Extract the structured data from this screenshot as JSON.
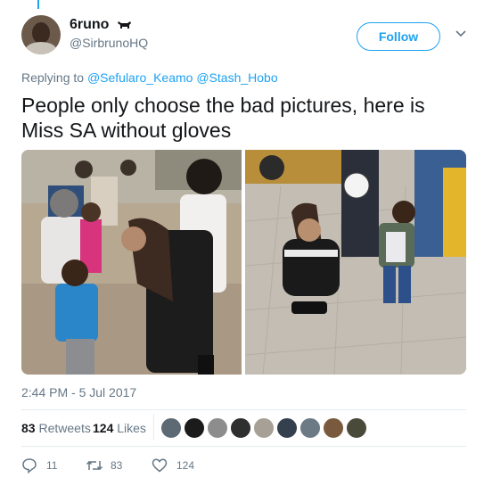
{
  "header": {
    "display_name": "6runo",
    "handle": "@SirbrunoHQ",
    "follow_label": "Follow"
  },
  "reply": {
    "prefix": "Replying to",
    "mentions": [
      "@Sefularo_Keamo",
      "@Stash_Hobo"
    ]
  },
  "tweet": {
    "text": "People only choose the bad pictures, here is Miss SA without gloves",
    "timestamp": "2:44 PM - 5 Jul 2017"
  },
  "stats": {
    "retweets_count": "83",
    "retweets_label": "Retweets",
    "likes_count": "124",
    "likes_label": "Likes"
  },
  "actions": {
    "reply_count": "11",
    "retweet_count": "83",
    "like_count": "124"
  },
  "icons": {
    "badge": "bull-icon",
    "menu": "chevron-down-icon",
    "reply": "reply-icon",
    "retweet": "retweet-icon",
    "like": "heart-icon"
  },
  "colors": {
    "accent": "#1da1f2",
    "text": "#14171a",
    "muted": "#657786",
    "divider": "#e6ecf0"
  }
}
